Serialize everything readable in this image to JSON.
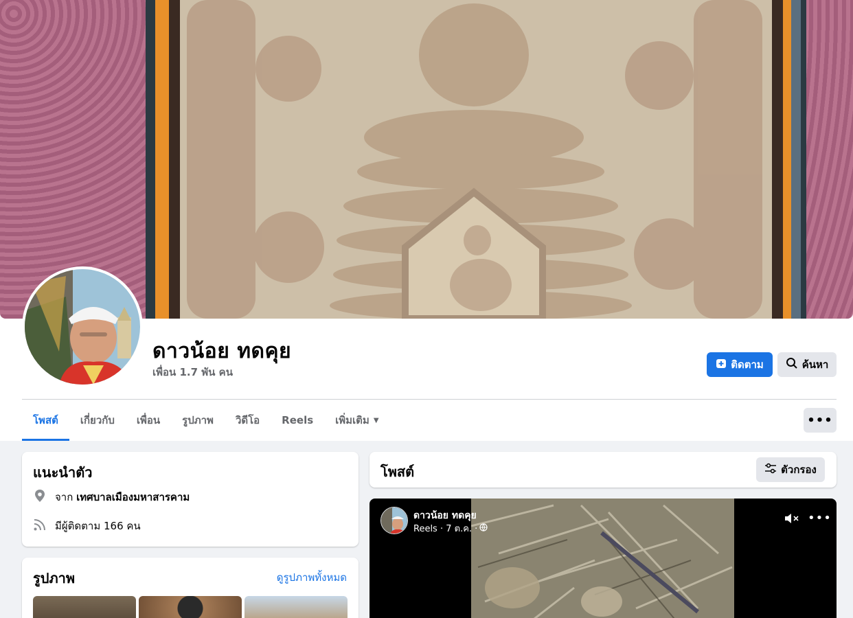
{
  "profile": {
    "name": "ดาวน้อย ทดคุย",
    "friends": "เพื่อน 1.7 พัน คน"
  },
  "actions": {
    "follow_label": "ติดตาม",
    "search_label": "ค้นหา"
  },
  "tabs": [
    {
      "label": "โพสต์",
      "active": true
    },
    {
      "label": "เกี่ยวกับ"
    },
    {
      "label": "เพื่อน"
    },
    {
      "label": "รูปภาพ"
    },
    {
      "label": "วิดีโอ"
    },
    {
      "label": "Reels"
    },
    {
      "label": "เพิ่มเติม"
    }
  ],
  "intro": {
    "title": "แนะนำตัว",
    "from_prefix": "จาก",
    "from_place": "เทศบาลเมืองมหาสารคาม",
    "followers": "มีผู้ติดตาม 166 คน"
  },
  "photos": {
    "title": "รูปภาพ",
    "see_all": "ดูรูปภาพทั้งหมด"
  },
  "posts": {
    "title": "โพสต์",
    "filter_label": "ตัวกรอง"
  },
  "reel": {
    "author": "ดาวน้อย ทดคุย",
    "meta": "Reels · 7 ต.ค. ·"
  },
  "colors": {
    "accent": "#1b74e4",
    "secondary_button": "#e4e6eb",
    "page_bg": "#f0f2f5",
    "muted_text": "#65676b"
  }
}
